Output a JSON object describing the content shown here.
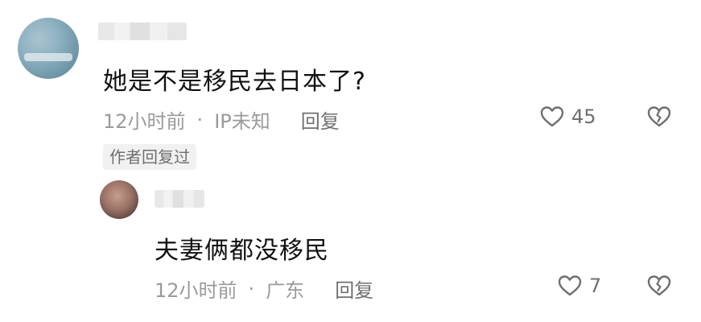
{
  "comment": {
    "text": "她是不是移民去日本了?",
    "time": "12小时前",
    "separator": "·",
    "location": "IP未知",
    "reply_label": "回复",
    "likes": "45",
    "author_badge": "作者回复过"
  },
  "reply": {
    "text": "夫妻俩都没移民",
    "time": "12小时前",
    "separator": "·",
    "location": "广东",
    "reply_label": "回复",
    "likes": "7"
  },
  "icons": {
    "like": "heart-outline-icon",
    "dislike": "broken-heart-icon"
  },
  "colors": {
    "meta_text": "#9a9a9a",
    "icon": "#6f6f6f"
  }
}
